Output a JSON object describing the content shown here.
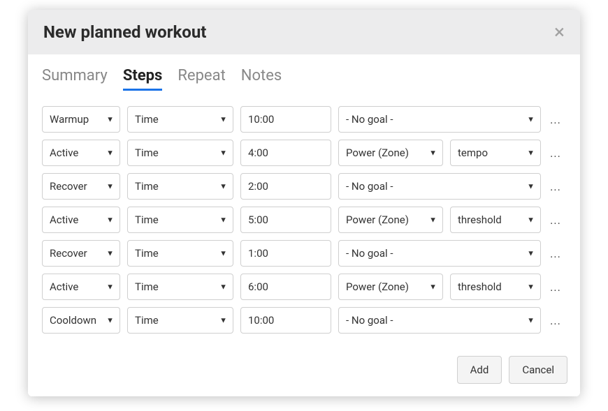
{
  "dialog": {
    "title": "New planned workout"
  },
  "tabs": {
    "summary": "Summary",
    "steps": "Steps",
    "repeat": "Repeat",
    "notes": "Notes",
    "active": "steps"
  },
  "steps": [
    {
      "type": "Warmup",
      "measure": "Time",
      "value": "10:00",
      "goal": "- No goal -",
      "zone": null
    },
    {
      "type": "Active",
      "measure": "Time",
      "value": "4:00",
      "goal": "Power (Zone)",
      "zone": "tempo"
    },
    {
      "type": "Recover",
      "measure": "Time",
      "value": "2:00",
      "goal": "- No goal -",
      "zone": null
    },
    {
      "type": "Active",
      "measure": "Time",
      "value": "5:00",
      "goal": "Power (Zone)",
      "zone": "threshold"
    },
    {
      "type": "Recover",
      "measure": "Time",
      "value": "1:00",
      "goal": "- No goal -",
      "zone": null
    },
    {
      "type": "Active",
      "measure": "Time",
      "value": "6:00",
      "goal": "Power (Zone)",
      "zone": "threshold"
    },
    {
      "type": "Cooldown",
      "measure": "Time",
      "value": "10:00",
      "goal": "- No goal -",
      "zone": null
    }
  ],
  "footer": {
    "add": "Add",
    "cancel": "Cancel"
  },
  "icons": {
    "more": "..."
  }
}
